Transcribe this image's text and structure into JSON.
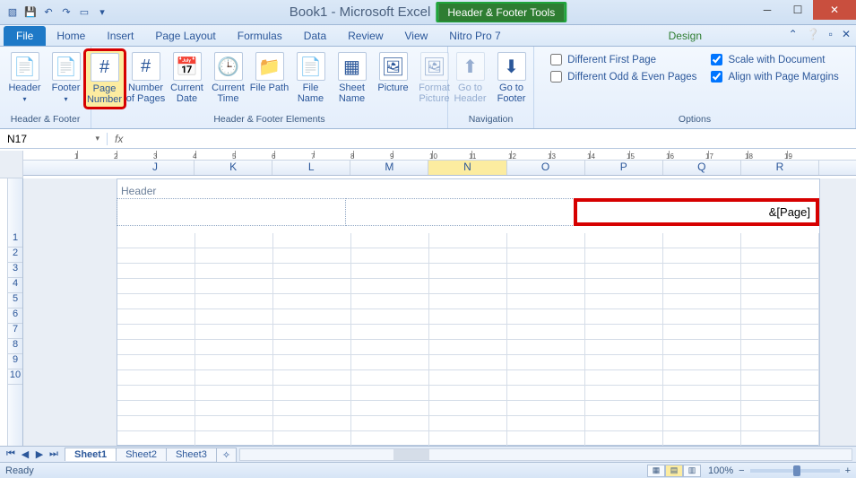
{
  "title": {
    "doc": "Book1 - Microsoft Excel",
    "context_tools": "Header & Footer Tools"
  },
  "qat_icons": [
    "excel-icon",
    "save-icon",
    "undo-icon",
    "redo-icon",
    "new-icon",
    "open-icon"
  ],
  "tabs": [
    "File",
    "Home",
    "Insert",
    "Page Layout",
    "Formulas",
    "Data",
    "Review",
    "View",
    "Nitro Pro 7",
    "Design"
  ],
  "ribbon": {
    "groups": {
      "hf": {
        "label": "Header & Footer",
        "items": [
          "Header",
          "Footer"
        ]
      },
      "elements": {
        "label": "Header & Footer Elements",
        "items": [
          "Page Number",
          "Number of Pages",
          "Current Date",
          "Current Time",
          "File Path",
          "File Name",
          "Sheet Name",
          "Picture",
          "Format Picture"
        ]
      },
      "nav": {
        "label": "Navigation",
        "items": [
          "Go to Header",
          "Go to Footer"
        ]
      },
      "options": {
        "label": "Options",
        "checks": [
          {
            "label": "Different First Page",
            "checked": false
          },
          {
            "label": "Different Odd & Even Pages",
            "checked": false
          },
          {
            "label": "Scale with Document",
            "checked": true
          },
          {
            "label": "Align with Page Margins",
            "checked": true
          }
        ]
      }
    }
  },
  "icons": {
    "Header": "📄",
    "Footer": "📄",
    "Page Number": "#",
    "Number of Pages": "#",
    "Current Date": "📅",
    "Current Time": "🕒",
    "File Path": "📁",
    "File Name": "📄",
    "Sheet Name": "▦",
    "Picture": "🖼",
    "Format Picture": "🖼",
    "Go to Header": "⬆",
    "Go to Footer": "⬇"
  },
  "formula_bar": {
    "name_box": "N17",
    "fx": "fx",
    "content": ""
  },
  "columns": [
    "J",
    "K",
    "L",
    "M",
    "N",
    "O",
    "P",
    "Q",
    "R"
  ],
  "active_col": "N",
  "rows_visible": [
    1,
    2,
    3,
    4,
    5,
    6,
    7,
    8,
    9,
    10
  ],
  "ruler_marks": [
    1,
    2,
    3,
    4,
    5,
    6,
    7,
    8,
    9,
    10,
    11,
    12,
    13,
    14,
    15,
    16,
    17,
    18,
    19
  ],
  "page": {
    "header_label": "Header",
    "header_right_value": "&[Page]"
  },
  "sheet_tabs": [
    "Sheet1",
    "Sheet2",
    "Sheet3"
  ],
  "active_sheet": "Sheet1",
  "status": {
    "text": "Ready",
    "zoom": "100%"
  }
}
